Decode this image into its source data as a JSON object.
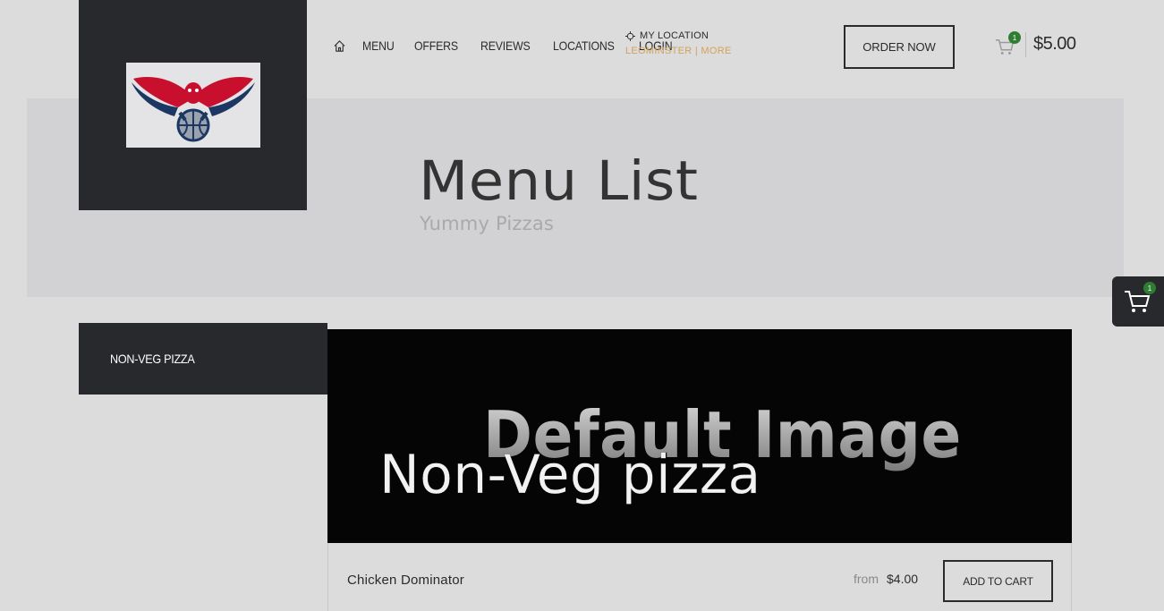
{
  "header": {
    "nav": [
      {
        "label": "MENU"
      },
      {
        "label": "OFFERS"
      },
      {
        "label": "REVIEWS"
      },
      {
        "label": "LOCATIONS"
      },
      {
        "label": "LOGIN"
      }
    ],
    "location": {
      "label": "MY LOCATION",
      "value": "LEOMINSTER | MORE"
    },
    "order_label": "ORDER NOW",
    "cart": {
      "count": "1",
      "total": "$5.00"
    }
  },
  "hero": {
    "title": "Menu List",
    "subtitle": "Yummy Pizzas"
  },
  "float_cart": {
    "count": "1"
  },
  "sidebar": {
    "items": [
      {
        "label": "NON-VEG PIZZA"
      }
    ]
  },
  "category": {
    "image_text": "Default Image",
    "title": "Non-Veg pizza"
  },
  "products": [
    {
      "name": "Chicken Dominator",
      "price_prefix": "from",
      "price": "$4.00",
      "button": "ADD TO CART"
    }
  ],
  "colors": {
    "dark_panel": "#27292c",
    "accent_gold": "#d1a35a",
    "badge_green": "#2e7d32",
    "background": "#dcdcdc"
  }
}
